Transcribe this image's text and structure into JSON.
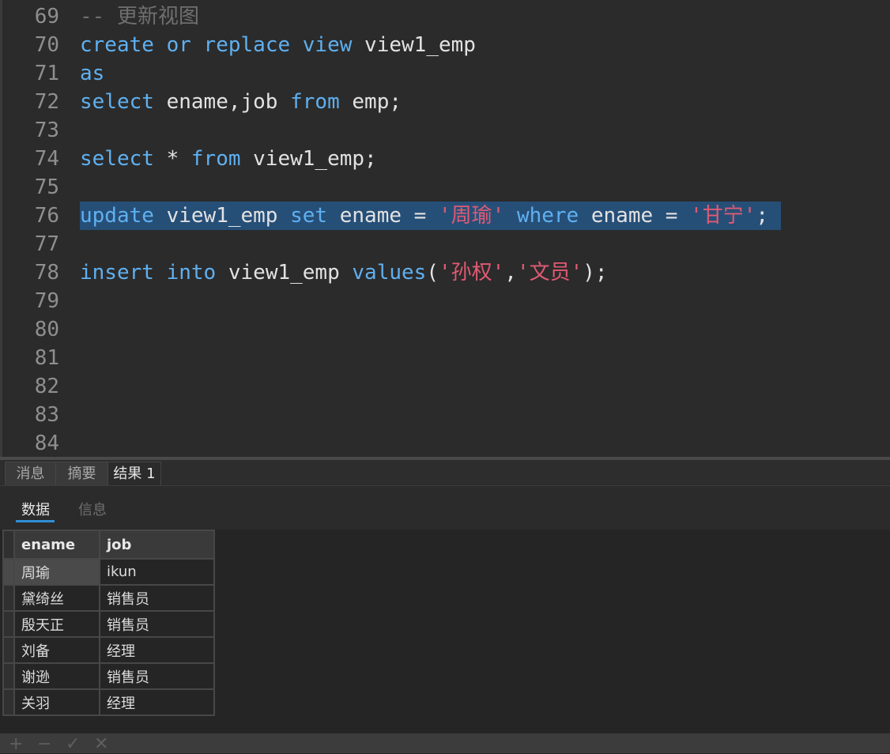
{
  "editor": {
    "lines": [
      {
        "num": "69",
        "tokens": [
          {
            "t": "-- 更新视图",
            "c": "cmt"
          }
        ]
      },
      {
        "num": "70",
        "tokens": [
          {
            "t": "create",
            "c": "kw"
          },
          {
            "t": " "
          },
          {
            "t": "or",
            "c": "kw"
          },
          {
            "t": " "
          },
          {
            "t": "replace",
            "c": "kw"
          },
          {
            "t": " "
          },
          {
            "t": "view",
            "c": "kw"
          },
          {
            "t": " view1_emp"
          }
        ]
      },
      {
        "num": "71",
        "tokens": [
          {
            "t": "as",
            "c": "kw"
          }
        ]
      },
      {
        "num": "72",
        "tokens": [
          {
            "t": "select",
            "c": "kw"
          },
          {
            "t": " ename,job "
          },
          {
            "t": "from",
            "c": "kw"
          },
          {
            "t": " emp;"
          }
        ]
      },
      {
        "num": "73",
        "tokens": []
      },
      {
        "num": "74",
        "tokens": [
          {
            "t": "select",
            "c": "kw"
          },
          {
            "t": " * "
          },
          {
            "t": "from",
            "c": "kw"
          },
          {
            "t": " view1_emp;"
          }
        ]
      },
      {
        "num": "75",
        "tokens": []
      },
      {
        "num": "76",
        "selected": true,
        "tokens": [
          {
            "t": "update",
            "c": "kw"
          },
          {
            "t": " view1_emp "
          },
          {
            "t": "set",
            "c": "kw"
          },
          {
            "t": " ename = "
          },
          {
            "t": "'周瑜'",
            "c": "str"
          },
          {
            "t": " "
          },
          {
            "t": "where",
            "c": "kw"
          },
          {
            "t": " ename = "
          },
          {
            "t": "'甘宁'",
            "c": "str"
          },
          {
            "t": ";"
          }
        ]
      },
      {
        "num": "77",
        "tokens": []
      },
      {
        "num": "78",
        "tokens": [
          {
            "t": "insert",
            "c": "kw"
          },
          {
            "t": " "
          },
          {
            "t": "into",
            "c": "kw"
          },
          {
            "t": " view1_emp "
          },
          {
            "t": "values",
            "c": "kw"
          },
          {
            "t": "("
          },
          {
            "t": "'孙权'",
            "c": "str"
          },
          {
            "t": ","
          },
          {
            "t": "'文员'",
            "c": "str"
          },
          {
            "t": ");"
          }
        ]
      },
      {
        "num": "79",
        "tokens": []
      },
      {
        "num": "80",
        "tokens": []
      },
      {
        "num": "81",
        "tokens": []
      },
      {
        "num": "82",
        "tokens": []
      },
      {
        "num": "83",
        "tokens": []
      },
      {
        "num": "84",
        "tokens": []
      }
    ]
  },
  "tabs": {
    "messages": "消息",
    "summary": "摘要",
    "result1": "结果 1",
    "active": "result1"
  },
  "subtabs": {
    "data": "数据",
    "info": "信息",
    "active": "data"
  },
  "grid": {
    "columns": [
      "ename",
      "job"
    ],
    "rows": [
      [
        "周瑜",
        "ikun"
      ],
      [
        "黛绮丝",
        "销售员"
      ],
      [
        "殷天正",
        "销售员"
      ],
      [
        "刘备",
        "经理"
      ],
      [
        "谢逊",
        "销售员"
      ],
      [
        "关羽",
        "经理"
      ]
    ],
    "selected_row": 0
  },
  "toolbar": {
    "add": "+",
    "remove": "−",
    "apply": "✓",
    "discard": "✕"
  },
  "colors": {
    "keyword": "#5fb0f0",
    "string": "#e05a73",
    "comment": "#6f6f6f",
    "selection": "#264f78",
    "accent": "#2f8fd8"
  }
}
